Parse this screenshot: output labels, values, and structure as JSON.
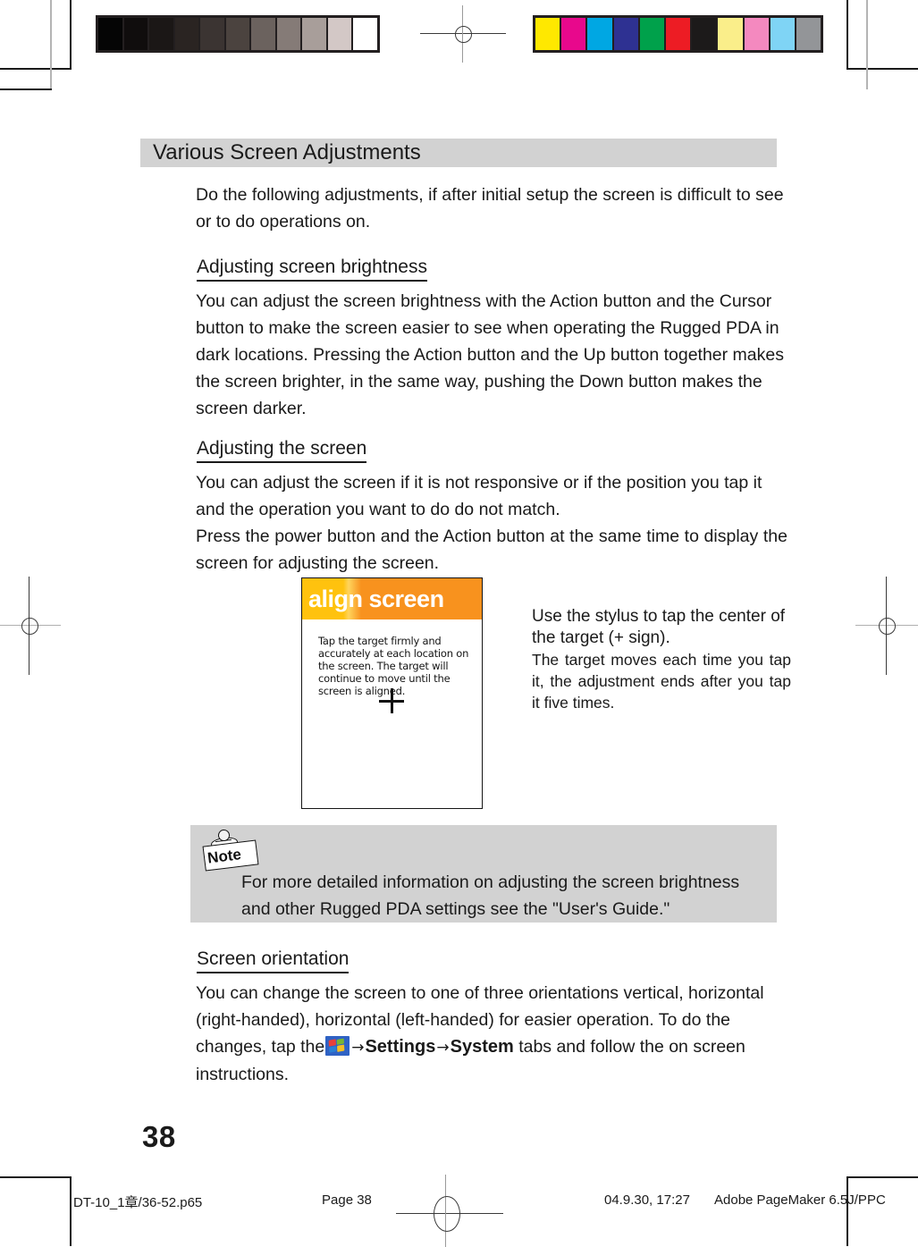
{
  "page": {
    "number": "38",
    "heading": "Various Screen Adjustments",
    "intro": "Do the following adjustments, if after initial setup the screen is difficult to see or to do operations on."
  },
  "sections": [
    {
      "heading": "Adjusting screen brightness",
      "body": "You can adjust the screen brightness with the Action button and the Cursor button to make the screen easier to see when operating the Rugged PDA in dark locations. Pressing the Action button and the Up button together makes the screen brighter, in the same way, pushing the Down button makes the screen darker."
    },
    {
      "heading": "Adjusting the screen",
      "body_line_1": "You can adjust the screen if it is not responsive or if the position you tap it and the operation you want to do do not match.",
      "body_line_2": "Press the power button and the Action button at the same time to display the screen for adjusting the screen."
    },
    {
      "heading": "Screen orientation",
      "body_line_1": "You can change the screen to one of three orientations vertical, horizontal (right-handed), horizontal (left-handed) for easier operation.",
      "body_line_2_prefix": "To do the changes, tap the",
      "start_icon_name": "windows-start-icon",
      "arrow_1": "→",
      "term_settings": "Settings",
      "arrow_2": "→",
      "term_system": "System",
      "body_line_2_suffix": "tabs and follow the on screen instructions."
    }
  ],
  "figure": {
    "screen_title": "align screen",
    "screen_instructions": "Tap the target firmly and accurately at each location on the screen. The target will continue to move until the screen is aligned.",
    "target_icon": "crosshair-target-icon",
    "caption_line_1": "Use the stylus to tap the center of the target (+ sign).",
    "caption_line_2": "The target moves each time you tap it, the adjustment ends after you tap it five times.",
    "header_color_left": "#ffc20e",
    "header_color_right": "#f8921e"
  },
  "note": {
    "icon_label": "Note",
    "text": "For more detailed information on adjusting the screen brightness and other Rugged PDA settings see the \"User's Guide.\"",
    "background_color": "#d2d2d2"
  },
  "footer": {
    "file": "DT-10_1章/36-52.p65",
    "page": "Page 38",
    "date": "04.9.30, 17:27",
    "app": "Adobe PageMaker 6.5J/PPC"
  },
  "calibration": {
    "grayscale_patches": [
      "#050505",
      "#100d0d",
      "#1b1716",
      "#2a2422",
      "#3b3432",
      "#4b433f",
      "#6b625e",
      "#857b77",
      "#a89e9a",
      "#d3c8c6",
      "#ffffff"
    ],
    "color_patches": [
      "#ffe800",
      "#e8088c",
      "#00a7e3",
      "#2e3192",
      "#00a14b",
      "#ed1c24",
      "#1c1a1a",
      "#faee8a",
      "#f489bf",
      "#7fd4f5",
      "#939598"
    ]
  }
}
